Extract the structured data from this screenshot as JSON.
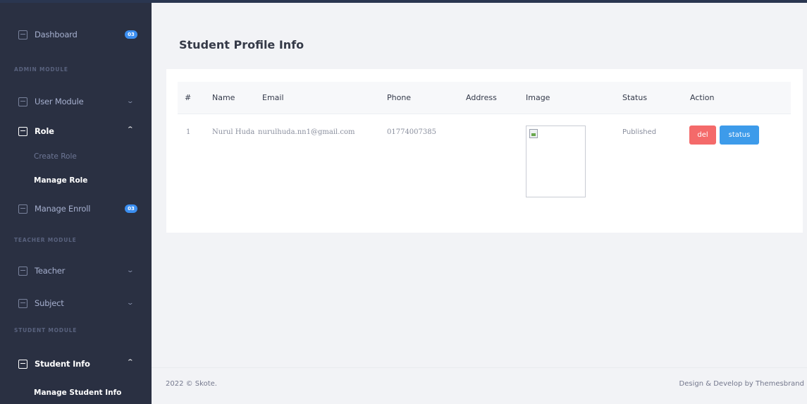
{
  "sidebar": {
    "items": {
      "dashboard": {
        "label": "Dashboard",
        "badge": "03"
      },
      "user_module": {
        "label": "User Module"
      },
      "role": {
        "label": "Role"
      },
      "manage_enroll": {
        "label": "Manage Enroll",
        "badge": "03"
      },
      "teacher": {
        "label": "Teacher"
      },
      "subject": {
        "label": "Subject"
      },
      "student_info": {
        "label": "Student Info"
      }
    },
    "sections": {
      "admin": "ADMIN MODULE",
      "teacher": "TEACHER MODULE",
      "student": "STUDENT MODULE"
    },
    "sub_items": {
      "create_role": "Create Role",
      "manage_role": "Manage Role",
      "manage_student_info": "Manage Student Info"
    }
  },
  "page": {
    "title": "Student Profile Info"
  },
  "table": {
    "columns": [
      "#",
      "Name",
      "Email",
      "Phone",
      "Address",
      "Image",
      "Status",
      "Action"
    ],
    "rows": [
      {
        "index": "1",
        "name": "Nurul Huda",
        "email": "nurulhuda.nn1@gmail.com",
        "phone": "01774007385",
        "address": "",
        "status": "Published",
        "actions": {
          "del": "del",
          "status": "status"
        }
      }
    ]
  },
  "footer": {
    "left": "2022 © Skote.",
    "right": "Design & Develop by Themesbrand"
  },
  "colors": {
    "sidebar_bg": "#2a3042",
    "accent_blue": "#3d9bea",
    "danger_red": "#f46a6a"
  }
}
